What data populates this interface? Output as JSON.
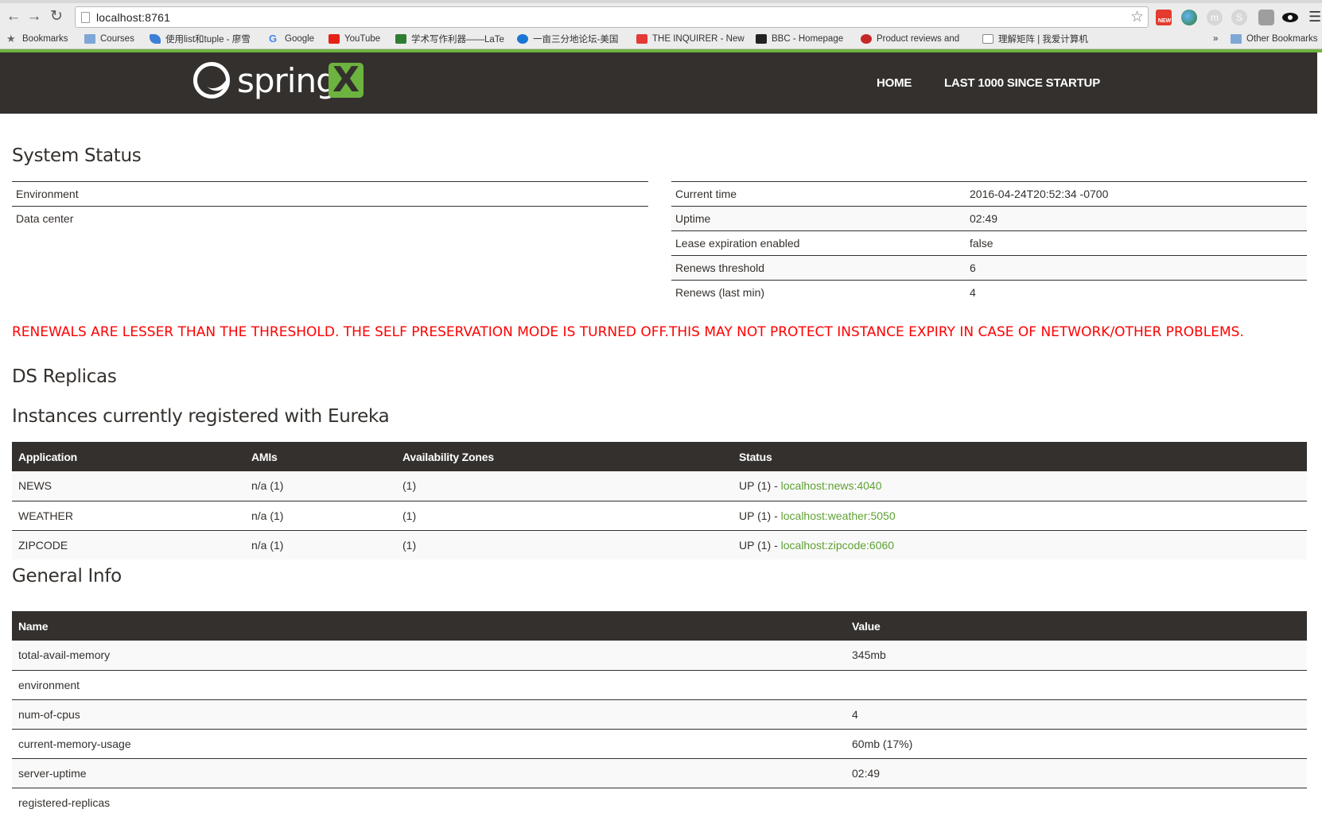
{
  "browser": {
    "url": "localhost:8761",
    "bookmarks": [
      {
        "label": "Bookmarks",
        "icon": "star-icon"
      },
      {
        "label": "Courses",
        "icon": "folder-icon"
      },
      {
        "label": "使用list和tuple - 廖雪",
        "icon": "rocket-icon"
      },
      {
        "label": "Google",
        "icon": "google-icon"
      },
      {
        "label": "YouTube",
        "icon": "youtube-icon"
      },
      {
        "label": "学术写作利器——LaTe",
        "icon": "green-square-icon"
      },
      {
        "label": "一亩三分地论坛-美国",
        "icon": "plane-icon"
      },
      {
        "label": "THE INQUIRER - New",
        "icon": "inquirer-icon"
      },
      {
        "label": "BBC - Homepage",
        "icon": "bbc-icon"
      },
      {
        "label": "Product reviews and",
        "icon": "cnet-icon"
      },
      {
        "label": "理解矩阵 | 我爱计算机",
        "icon": "document-icon"
      },
      {
        "label": "»",
        "icon": "chevron-right-icon"
      },
      {
        "label": "Other Bookmarks",
        "icon": "folder-icon"
      }
    ]
  },
  "header": {
    "logo_text": "spring",
    "logo_badge": "X",
    "nav": [
      "HOME",
      "LAST 1000 SINCE STARTUP"
    ]
  },
  "system_status": {
    "title": "System Status",
    "left": [
      {
        "key": "Environment",
        "value": ""
      },
      {
        "key": "Data center",
        "value": ""
      }
    ],
    "right": [
      {
        "key": "Current time",
        "value": "2016-04-24T20:52:34 -0700"
      },
      {
        "key": "Uptime",
        "value": "02:49"
      },
      {
        "key": "Lease expiration enabled",
        "value": "false"
      },
      {
        "key": "Renews threshold",
        "value": "6"
      },
      {
        "key": "Renews (last min)",
        "value": "4"
      }
    ]
  },
  "alert": "RENEWALS ARE LESSER THAN THE THRESHOLD. THE SELF PRESERVATION MODE IS TURNED OFF.THIS MAY NOT PROTECT INSTANCE EXPIRY IN CASE OF NETWORK/OTHER PROBLEMS.",
  "ds_replicas": {
    "title": "DS Replicas"
  },
  "instances": {
    "title": "Instances currently registered with Eureka",
    "columns": [
      "Application",
      "AMIs",
      "Availability Zones",
      "Status"
    ],
    "rows": [
      {
        "app": "NEWS",
        "amis": "n/a (1)",
        "zones": "(1)",
        "status": "UP (1) - ",
        "link": "localhost:news:4040"
      },
      {
        "app": "WEATHER",
        "amis": "n/a (1)",
        "zones": "(1)",
        "status": "UP (1) - ",
        "link": "localhost:weather:5050"
      },
      {
        "app": "ZIPCODE",
        "amis": "n/a (1)",
        "zones": "(1)",
        "status": "UP (1) - ",
        "link": "localhost:zipcode:6060"
      }
    ]
  },
  "general_info": {
    "title": "General Info",
    "columns": [
      "Name",
      "Value"
    ],
    "rows": [
      {
        "name": "total-avail-memory",
        "value": "345mb"
      },
      {
        "name": "environment",
        "value": ""
      },
      {
        "name": "num-of-cpus",
        "value": "4"
      },
      {
        "name": "current-memory-usage",
        "value": "60mb (17%)"
      },
      {
        "name": "server-uptime",
        "value": "02:49"
      },
      {
        "name": "registered-replicas",
        "value": ""
      }
    ]
  },
  "colors": {
    "header_bg": "#34302d",
    "accent_green": "#6db33f",
    "link_green": "#5fa134",
    "alert_red": "#ff0000"
  }
}
